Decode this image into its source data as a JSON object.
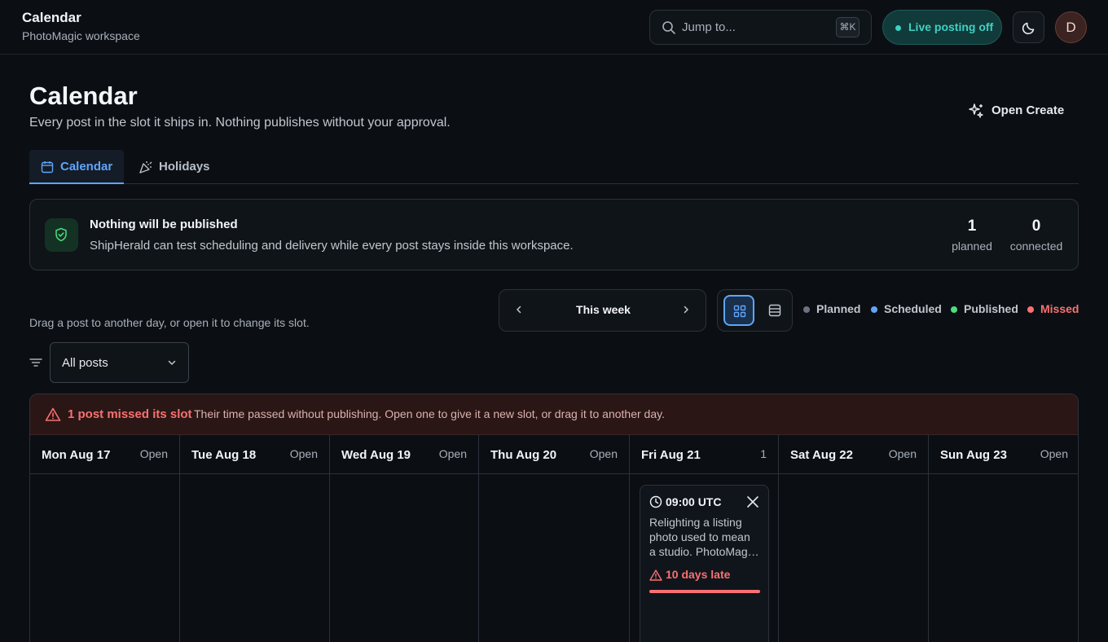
{
  "app": {
    "title": "Calendar",
    "workspace": "PhotoMagic workspace"
  },
  "search": {
    "placeholder": "Jump to...",
    "shortcut": "⌘K"
  },
  "live_posting": {
    "label": "Live posting off"
  },
  "user": {
    "initial": "D"
  },
  "page": {
    "title": "Calendar",
    "subtitle": "Every post in the slot it ships in. Nothing publishes without your approval.",
    "open_create": "Open Create"
  },
  "tabs": [
    {
      "label": "Calendar"
    },
    {
      "label": "Holidays"
    }
  ],
  "notice": {
    "title": "Nothing will be published",
    "text": "ShipHerald can test scheduling and delivery while every post stays inside this workspace.",
    "stats": [
      {
        "value": "1",
        "label": "planned"
      },
      {
        "value": "0",
        "label": "connected"
      }
    ]
  },
  "controls": {
    "hint": "Drag a post to another day, or open it to change its slot.",
    "week_label": "This week",
    "filter_value": "All posts"
  },
  "legend": [
    {
      "label": "Planned",
      "color": "#6b7280"
    },
    {
      "label": "Scheduled",
      "color": "#60a5fa"
    },
    {
      "label": "Published",
      "color": "#4ade80"
    },
    {
      "label": "Missed",
      "color": "#f87171"
    }
  ],
  "missed": {
    "title": "1 post missed its slot",
    "text": "Their time passed without publishing. Open one to give it a new slot, or drag it to another day."
  },
  "days": [
    {
      "name": "Mon Aug 17",
      "action": "Open"
    },
    {
      "name": "Tue Aug 18",
      "action": "Open"
    },
    {
      "name": "Wed Aug 19",
      "action": "Open"
    },
    {
      "name": "Thu Aug 20",
      "action": "Open"
    },
    {
      "name": "Fri Aug 21",
      "action": "1"
    },
    {
      "name": "Sat Aug 22",
      "action": "Open"
    },
    {
      "name": "Sun Aug 23",
      "action": "Open"
    }
  ],
  "post": {
    "time": "09:00 UTC",
    "lines": [
      "Relighting a listing",
      "photo used to mean",
      "a studio. PhotoMagic…"
    ],
    "late": "10 days late",
    "late_progress": 1.0
  }
}
